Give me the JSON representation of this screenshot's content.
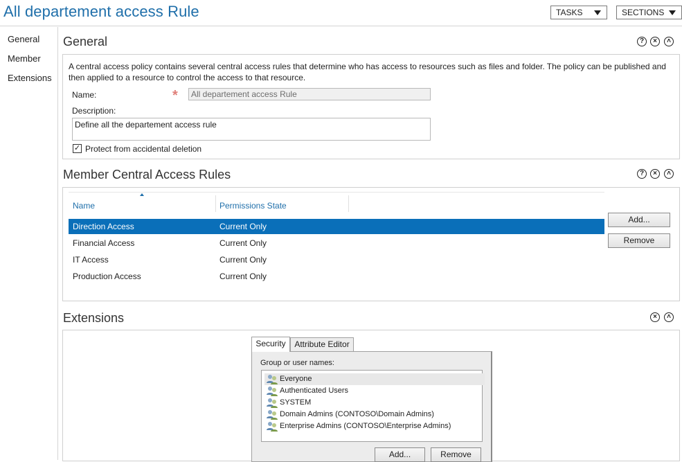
{
  "window": {
    "title": "All departement access Rule"
  },
  "toolbar": {
    "tasks_label": "TASKS",
    "sections_label": "SECTIONS"
  },
  "nav": {
    "items": [
      {
        "label": "General"
      },
      {
        "label": "Member"
      },
      {
        "label": "Extensions"
      }
    ]
  },
  "general": {
    "title": "General",
    "description_text": "A central access policy contains several central access rules that determine who has access to resources such as files and folder. The policy can be published and then applied to a resource to control the access to that resource.",
    "name_label": "Name:",
    "name_value": "All departement access Rule",
    "description_label": "Description:",
    "description_value": "Define all the departement access rule",
    "protect_label": "Protect from accidental deletion",
    "protect_checked": true
  },
  "member": {
    "title": "Member Central Access Rules",
    "columns": {
      "name": "Name",
      "permissions": "Permissions State"
    },
    "rows": [
      {
        "name": "Direction Access",
        "state": "Current Only",
        "selected": true
      },
      {
        "name": "Financial Access",
        "state": "Current Only",
        "selected": false
      },
      {
        "name": "IT Access",
        "state": "Current Only",
        "selected": false
      },
      {
        "name": "Production Access",
        "state": "Current Only",
        "selected": false
      }
    ],
    "add_label": "Add...",
    "remove_label": "Remove"
  },
  "extensions": {
    "title": "Extensions",
    "tabs": [
      {
        "label": "Security",
        "active": true
      },
      {
        "label": "Attribute Editor",
        "active": false
      }
    ],
    "group_label": "Group or user names:",
    "users": [
      {
        "name": "Everyone"
      },
      {
        "name": "Authenticated Users"
      },
      {
        "name": "SYSTEM"
      },
      {
        "name": "Domain Admins (CONTOSO\\Domain Admins)"
      },
      {
        "name": "Enterprise Admins (CONTOSO\\Enterprise Admins)"
      }
    ],
    "add_label": "Add...",
    "remove_label": "Remove"
  },
  "icons": {
    "help": "help-icon",
    "close": "close-icon",
    "collapse": "collapse-icon",
    "required": "required-asterisk-icon",
    "user_group": "user-group-icon"
  },
  "colors": {
    "accent": "#1f6faa",
    "selection": "#0a6fb9"
  }
}
